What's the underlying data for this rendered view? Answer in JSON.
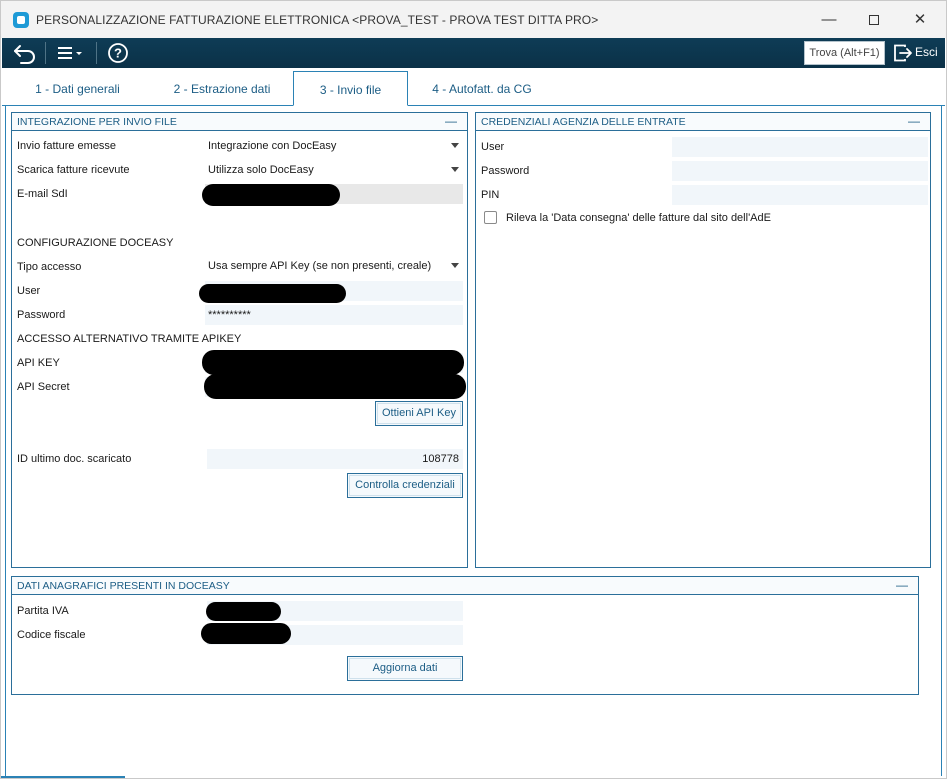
{
  "window": {
    "title": "PERSONALIZZAZIONE FATTURAZIONE ELETTRONICA <PROVA_TEST - PROVA TEST DITTA PRO>",
    "min_icon": "minimize-icon",
    "max_icon": "maximize-icon",
    "close_icon": "close-icon",
    "min_glyph": "—",
    "close_glyph": "✕"
  },
  "toolbar": {
    "search_label": "Trova (Alt+F1)",
    "exit_label": "Esci",
    "help_glyph": "?"
  },
  "tabs": [
    {
      "label": "1 - Dati generali",
      "active": false
    },
    {
      "label": "2 - Estrazione dati",
      "active": false
    },
    {
      "label": "3 - Invio file",
      "active": true
    },
    {
      "label": "4 - Autofatt. da CG",
      "active": false
    }
  ],
  "integrazione": {
    "title": "INTEGRAZIONE PER INVIO FILE",
    "collapse_glyph": "—",
    "invio_label": "Invio fatture emesse",
    "invio_value": "Integrazione con DocEasy",
    "scarica_label": "Scarica fatture ricevute",
    "scarica_value": "Utilizza solo DocEasy",
    "email_label": "E-mail SdI",
    "config_title": "CONFIGURAZIONE DOCEASY",
    "tipo_label": "Tipo accesso",
    "tipo_value": "Usa sempre API Key (se non presenti, creale)",
    "user_label": "User",
    "password_label": "Password",
    "password_value": "**********",
    "alt_title": "ACCESSO ALTERNATIVO TRAMITE APIKEY",
    "apikey_label": "API KEY",
    "apisecret_label": "API Secret",
    "ottieni_button": "Ottieni API Key",
    "id_label": "ID ultimo doc. scaricato",
    "id_value": "108778",
    "controlla_button": "Controlla credenziali"
  },
  "credenziali": {
    "title": "CREDENZIALI AGENZIA DELLE ENTRATE",
    "collapse_glyph": "—",
    "user_label": "User",
    "password_label": "Password",
    "pin_label": "PIN",
    "rileva_label": "Rileva la 'Data consegna' delle fatture dal sito dell'AdE",
    "rileva_checked": false
  },
  "anagrafici": {
    "title": "DATI ANAGRAFICI PRESENTI IN DOCEASY",
    "collapse_glyph": "—",
    "piva_label": "Partita IVA",
    "cf_label": "Codice fiscale",
    "aggiorna_button": "Aggiorna dati"
  },
  "colors": {
    "toolbar": "#0e3c56",
    "accent": "#2b82b5",
    "text_accent": "#1c5d85"
  }
}
